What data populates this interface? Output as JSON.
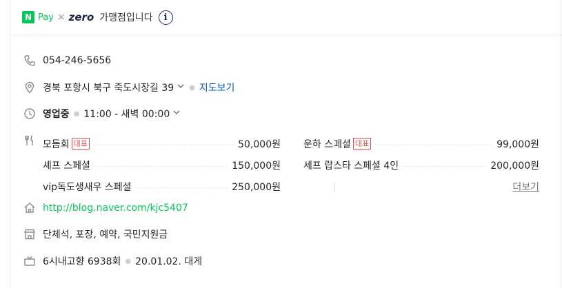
{
  "header": {
    "n_logo": "N",
    "pay_text": "Pay",
    "times": "×",
    "zero_text": "zero",
    "merchant_text": "가맹점입니다",
    "info_symbol": "i"
  },
  "phone": "054-246-5656",
  "address": {
    "text": "경북 포항시 북구 죽도시장길 39",
    "map_link": "지도보기"
  },
  "hours": {
    "status": "영업중",
    "range": "11:00 - 새벽 00:00"
  },
  "menu": {
    "items": [
      {
        "name": "모듬회",
        "badge": "대표",
        "price": "50,000원"
      },
      {
        "name": "운하 스페셜",
        "badge": "대표",
        "price": "99,000원"
      },
      {
        "name": "셰프 스페셜",
        "badge": "",
        "price": "150,000원"
      },
      {
        "name": "세프 랍스타 스페셜 4인",
        "badge": "",
        "price": "200,000원"
      },
      {
        "name": "vip독도생새우 스페셜",
        "badge": "",
        "price": "250,000원"
      }
    ],
    "more_label": "더보기"
  },
  "homepage": "http://blog.naver.com/kjc5407",
  "amenities": "단체석, 포장, 예약, 국민지원금",
  "tv": {
    "program": "6시내고향 6938회",
    "date": "20.01.02. 대게"
  },
  "colors": {
    "naver_green": "#03c75a",
    "link_blue": "#0a54c6",
    "badge_red": "#e14b4b",
    "info_navy": "#1b2a8a"
  },
  "icons": [
    "phone-icon",
    "location-pin-icon",
    "clock-icon",
    "fork-knife-icon",
    "home-icon",
    "store-icon",
    "tv-icon",
    "info-icon",
    "chevron-down-icon"
  ]
}
